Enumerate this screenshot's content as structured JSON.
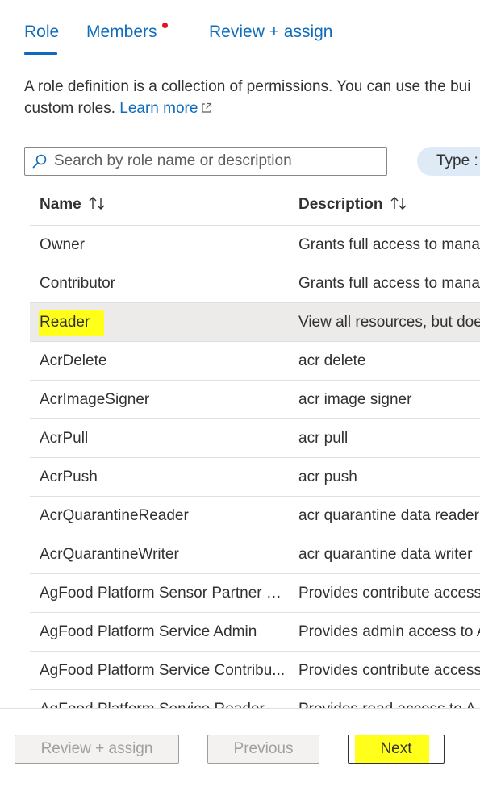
{
  "tabs": [
    {
      "label": "Role",
      "active": true
    },
    {
      "label": "Members",
      "has_notification": true
    },
    {
      "label": "Review + assign"
    }
  ],
  "description": {
    "line1": "A role definition is a collection of permissions. You can use the bui",
    "line2": "custom roles.",
    "learn_more": "Learn more"
  },
  "search": {
    "placeholder": "Search by role name or description",
    "value": ""
  },
  "filter": {
    "type_label": "Type :"
  },
  "table": {
    "columns": [
      "Name",
      "Description"
    ],
    "rows": [
      {
        "name": "Owner",
        "description": "Grants full access to mana"
      },
      {
        "name": "Contributor",
        "description": "Grants full access to mana"
      },
      {
        "name": "Reader",
        "description": "View all resources, but doe",
        "selected": true
      },
      {
        "name": "AcrDelete",
        "description": "acr delete"
      },
      {
        "name": "AcrImageSigner",
        "description": "acr image signer"
      },
      {
        "name": "AcrPull",
        "description": "acr pull"
      },
      {
        "name": "AcrPush",
        "description": "acr push"
      },
      {
        "name": "AcrQuarantineReader",
        "description": "acr quarantine data reader"
      },
      {
        "name": "AcrQuarantineWriter",
        "description": "acr quarantine data writer"
      },
      {
        "name": "AgFood Platform Sensor Partner C...",
        "description": "Provides contribute access"
      },
      {
        "name": "AgFood Platform Service Admin",
        "description": "Provides admin access to A"
      },
      {
        "name": "AgFood Platform Service Contribu...",
        "description": "Provides contribute access"
      },
      {
        "name": "AgFood Platform Service Reader",
        "description": "Provides read access to A"
      }
    ]
  },
  "footer": {
    "review_assign_label": "Review + assign",
    "previous_label": "Previous",
    "next_label": "Next"
  },
  "colors": {
    "accent": "#0f6cbd",
    "highlight": "#ffff19",
    "selected_row": "#edebe9",
    "notification_dot": "#e81123"
  }
}
